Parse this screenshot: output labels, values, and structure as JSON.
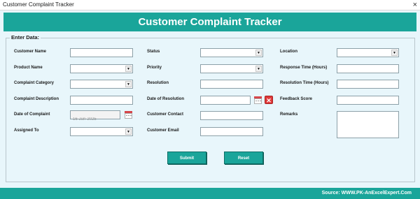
{
  "window": {
    "title": "Customer Complaint Tracker",
    "close_glyph": "×"
  },
  "header": {
    "title": "Customer Complaint Tracker"
  },
  "group": {
    "legend": "Enter Data:"
  },
  "col1": {
    "customer_name": {
      "label": "Customer Name",
      "value": ""
    },
    "product_name": {
      "label": "Product Name",
      "value": ""
    },
    "complaint_category": {
      "label": "Complaint Category",
      "value": ""
    },
    "complaint_description": {
      "label": "Complaint Description",
      "value": ""
    },
    "date_of_complaint": {
      "label": "Date of Complaint",
      "value": "16-Jun-2025"
    },
    "assigned_to": {
      "label": "Assigned To",
      "value": ""
    }
  },
  "col2": {
    "status": {
      "label": "Status",
      "value": ""
    },
    "priority": {
      "label": "Priority",
      "value": ""
    },
    "resolution": {
      "label": "Resolution",
      "value": ""
    },
    "date_of_resolution": {
      "label": "Date of Resolution",
      "value": ""
    },
    "customer_contact": {
      "label": "Customer Contact",
      "value": ""
    },
    "customer_email": {
      "label": "Customer Email",
      "value": ""
    }
  },
  "col3": {
    "location": {
      "label": "Location",
      "value": ""
    },
    "response_time": {
      "label": "Response Time (Hours)",
      "value": ""
    },
    "resolution_time": {
      "label": "Resolution Time (Hours)",
      "value": ""
    },
    "feedback_score": {
      "label": "Feedback Score",
      "value": ""
    },
    "remarks": {
      "label": "Remarks",
      "value": ""
    }
  },
  "buttons": {
    "submit": "Submit",
    "reset": "Reset"
  },
  "footer": {
    "source": "Source: WWW.PK-AnExcelExpert.Com"
  },
  "icons": {
    "dropdown": "▼",
    "delete": "✕"
  },
  "colors": {
    "accent": "#1aa59a",
    "form_bg": "#e8f6fb"
  }
}
